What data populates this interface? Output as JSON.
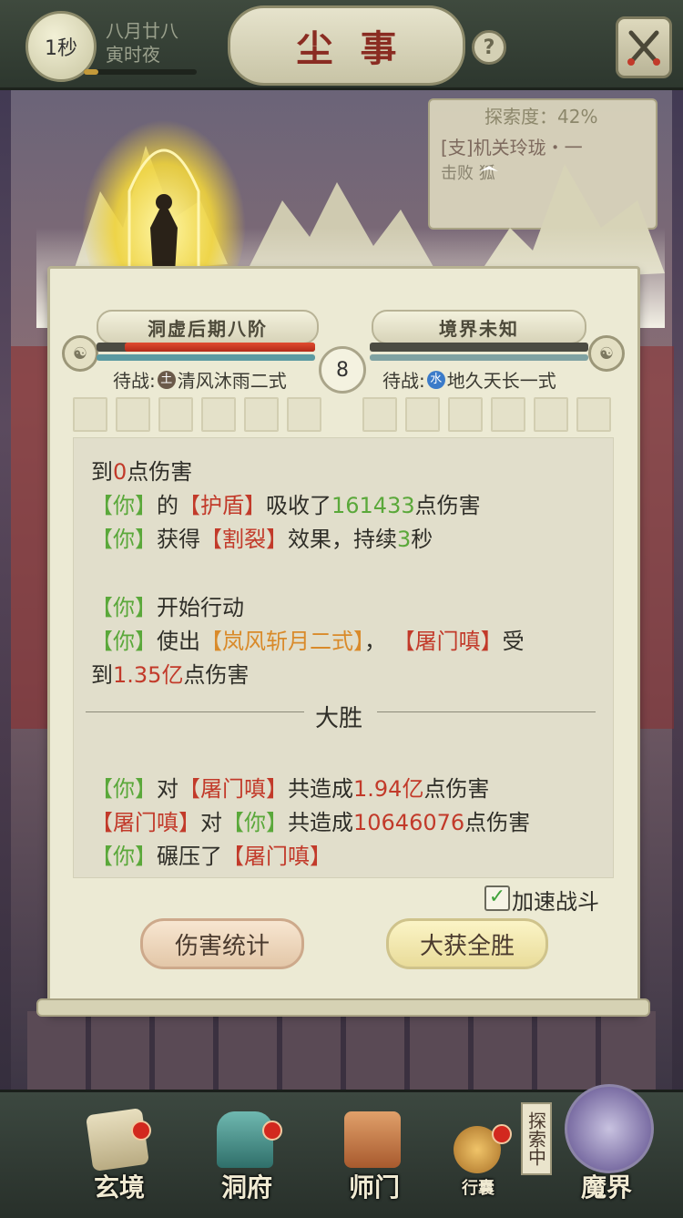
{
  "header": {
    "timer": "1秒",
    "date_line1": "八月廿八",
    "date_line2": "寅时夜",
    "title": "尘事",
    "help_glyph": "?",
    "time_progress": 0.13
  },
  "background": {
    "explore_label": "探索度：42%",
    "explore_quest_1": "[支]机关玲珑・一",
    "explore_quest_2": "击败 狐"
  },
  "battle": {
    "left": {
      "rank": "洞虚后期八阶",
      "standby_prefix": "待战:",
      "element": "土",
      "element_color": "#6b5a4a",
      "skill": "清风沐雨二式",
      "hp_ratio": 0.87
    },
    "right": {
      "rank": "境界未知",
      "standby_prefix": "待战:",
      "element": "水",
      "element_color": "#3b7bc9",
      "skill": "地久天长一式",
      "hp_ratio": 0.0
    },
    "round": "8",
    "slot_count_each_side": 6
  },
  "log": {
    "l1a": "到",
    "l1b": "0",
    "l1c": "点伤害",
    "l2a": "【你】",
    "l2b": "的",
    "l2c": "【护盾】",
    "l2d": "吸收了",
    "l2e": "161433",
    "l2f": "点伤害",
    "l3a": "【你】",
    "l3b": "获得",
    "l3c": "【割裂】",
    "l3d": "效果，持续",
    "l3e": "3",
    "l3f": "秒",
    "l4a": "【你】",
    "l4b": "开始行动",
    "l5a": "【你】",
    "l5b": "使出",
    "l5c": "【岚风斩月二式】",
    "l5d": "，",
    "l5e": "【屠门嗔】",
    "l5f": "受",
    "l6a": "到",
    "l6b": "1.35亿",
    "l6c": "点伤害",
    "victory": "大胜",
    "s1a": "【你】",
    "s1b": "对",
    "s1c": "【屠门嗔】",
    "s1d": "共造成",
    "s1e": "1.94亿",
    "s1f": "点伤害",
    "s2a": "【屠门嗔】",
    "s2b": "对",
    "s2c": "【你】",
    "s2d": "共造成",
    "s2e": "10646076",
    "s2f": "点伤害",
    "s3a": "【你】",
    "s3b": "碾压了",
    "s3c": "【屠门嗔】"
  },
  "controls": {
    "speed_label": "加速战斗",
    "speed_checked": true,
    "damage_stats_button": "伤害统计",
    "victory_button": "大获全胜"
  },
  "nav": {
    "items": [
      {
        "label": "玄境",
        "badge": true
      },
      {
        "label": "洞府",
        "badge": true
      },
      {
        "label": "师门",
        "badge": false
      },
      {
        "label": "行囊",
        "badge": true
      },
      {
        "label": "魔界",
        "badge": false
      }
    ],
    "exploring_tag": "探索中"
  }
}
